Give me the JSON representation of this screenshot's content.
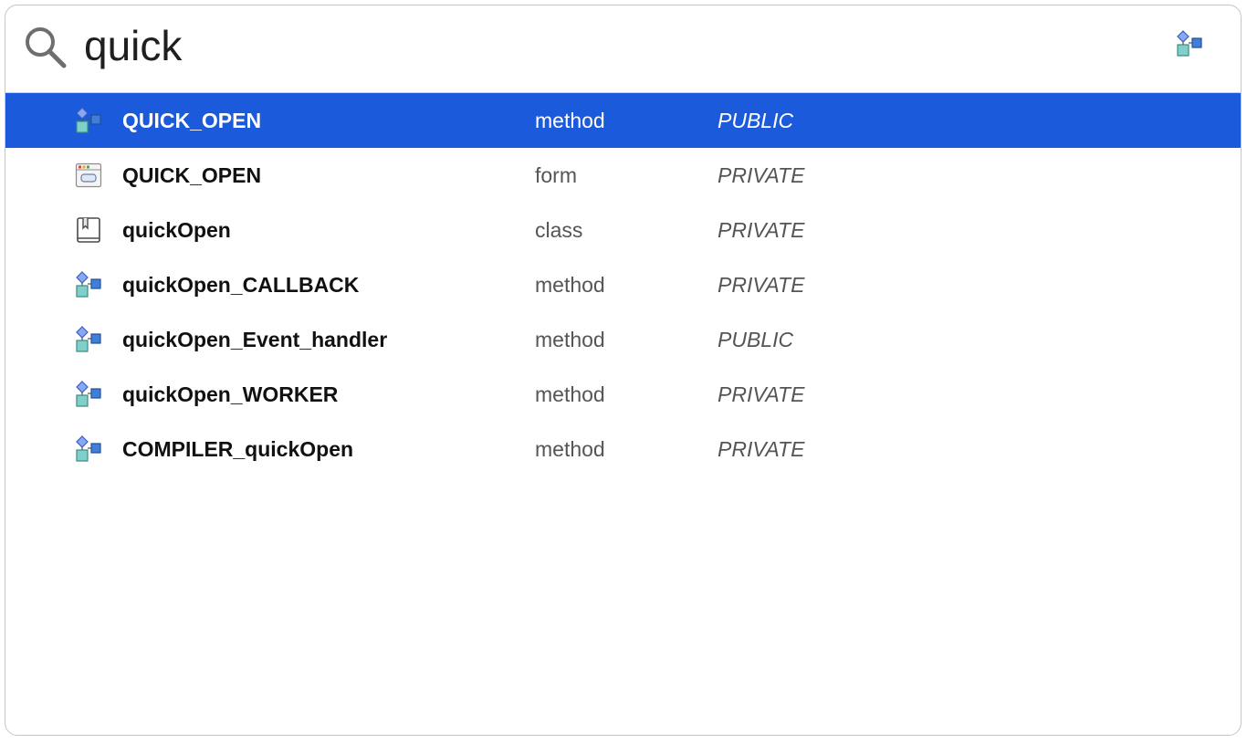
{
  "search": {
    "value": "quick",
    "icon": "search-icon",
    "filter_icon": "method-icon"
  },
  "colors": {
    "selection": "#1a5adb"
  },
  "results": [
    {
      "name": "QUICK_OPEN",
      "type": "method",
      "scope": "PUBLIC",
      "icon": "method-icon",
      "selected": true
    },
    {
      "name": "QUICK_OPEN",
      "type": "form",
      "scope": "PRIVATE",
      "icon": "form-icon",
      "selected": false
    },
    {
      "name": "quickOpen",
      "type": "class",
      "scope": "PRIVATE",
      "icon": "class-icon",
      "selected": false
    },
    {
      "name": "quickOpen_CALLBACK",
      "type": "method",
      "scope": "PRIVATE",
      "icon": "method-icon",
      "selected": false
    },
    {
      "name": "quickOpen_Event_handler",
      "type": "method",
      "scope": "PUBLIC",
      "icon": "method-icon",
      "selected": false
    },
    {
      "name": "quickOpen_WORKER",
      "type": "method",
      "scope": "PRIVATE",
      "icon": "method-icon",
      "selected": false
    },
    {
      "name": "COMPILER_quickOpen",
      "type": "method",
      "scope": "PRIVATE",
      "icon": "method-icon",
      "selected": false
    }
  ]
}
